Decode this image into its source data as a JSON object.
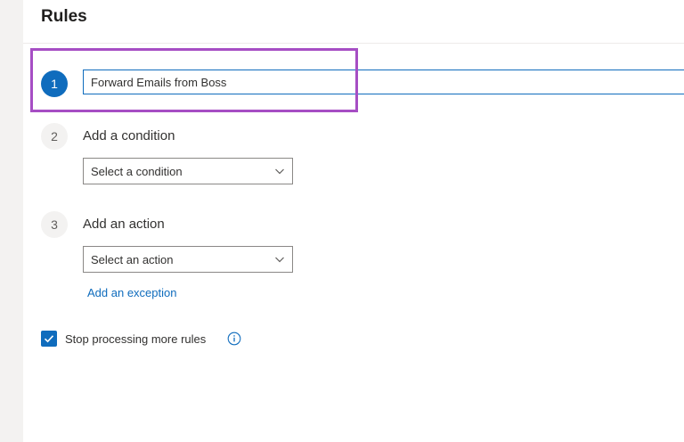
{
  "header": {
    "title": "Rules"
  },
  "steps": {
    "one": {
      "number": "1"
    },
    "two": {
      "number": "2",
      "label": "Add a condition"
    },
    "three": {
      "number": "3",
      "label": "Add an action"
    }
  },
  "rule_name": {
    "value": "Forward Emails from Boss"
  },
  "condition": {
    "selected": "Select a condition"
  },
  "action": {
    "selected": "Select an action"
  },
  "exception": {
    "link_label": "Add an exception"
  },
  "stop_processing": {
    "label": "Stop processing more rules",
    "checked": true
  },
  "colors": {
    "accent": "#0f6cbd",
    "highlight": "#a64ec4"
  },
  "icons": {
    "dropdown": "chevron-down-icon",
    "check": "checkmark-icon",
    "info": "info-icon"
  }
}
